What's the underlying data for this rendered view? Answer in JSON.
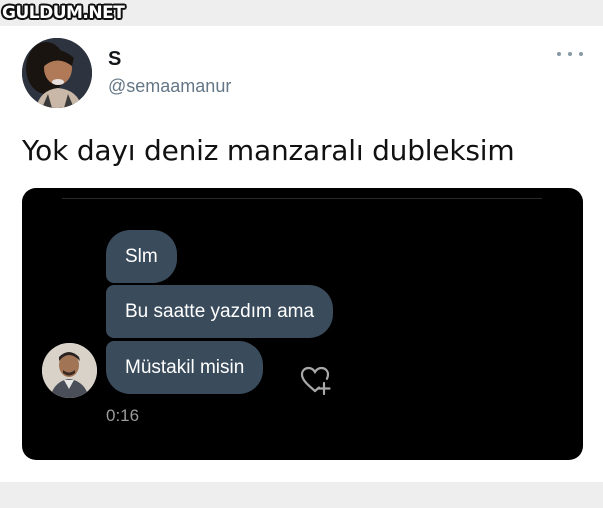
{
  "watermark": {
    "text": "GULDUM.NET"
  },
  "tweet": {
    "display_name": "S",
    "handle": "@semaamanur",
    "text": "Yok dayı deniz manzaralı dubleksim",
    "more_icon": "more-horizontal-icon"
  },
  "media": {
    "messages": [
      {
        "text": "Slm"
      },
      {
        "text": "Bu saatte yazdım ama"
      },
      {
        "text": "Müstakil misin"
      }
    ],
    "timestamp": "0:16",
    "react_icon": "heart-plus-icon"
  },
  "colors": {
    "bubble": "#3a4b5c",
    "media_background": "#000000",
    "handle": "#657786"
  }
}
